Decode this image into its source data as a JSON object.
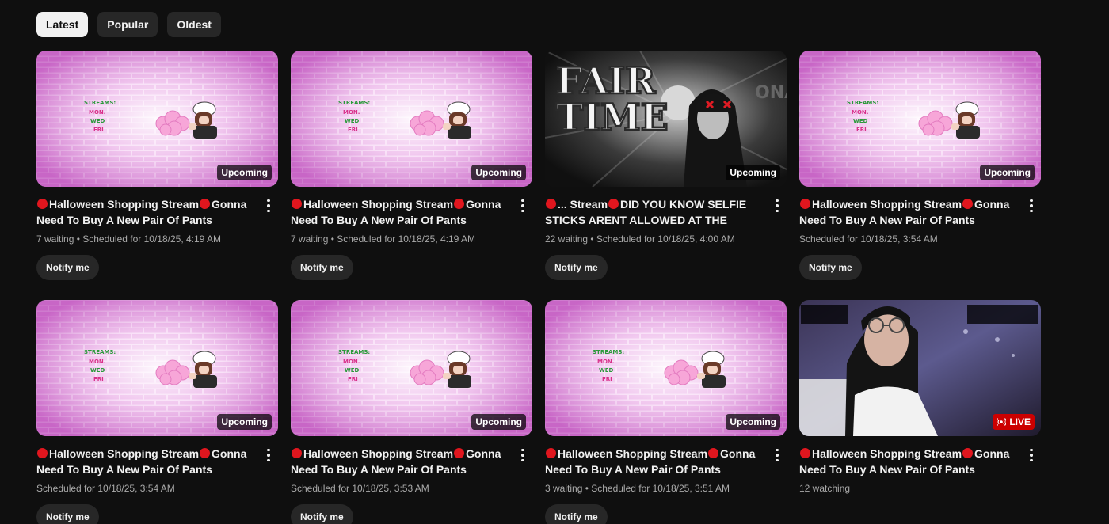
{
  "filters": [
    {
      "label": "Latest",
      "active": true
    },
    {
      "label": "Popular",
      "active": false
    },
    {
      "label": "Oldest",
      "active": false
    }
  ],
  "thumbnail_texts": {
    "fair_time_l1": "FAIR",
    "fair_time_l2": "TIME",
    "streams_sign": "STREAMS: MON. WED FRI"
  },
  "videos": [
    {
      "thumb": "brick",
      "badge": "Upcoming",
      "title_parts": [
        "",
        "Halloween Shopping Stream",
        "Gonna Need To Buy A New Pair Of Pants AFTER..."
      ],
      "sub": "7 waiting • Scheduled for 10/18/25, 4:19 AM",
      "action": "Notify me"
    },
    {
      "thumb": "brick",
      "badge": "Upcoming",
      "title_parts": [
        "",
        "Halloween Shopping Stream",
        "Gonna Need To Buy A New Pair Of Pants AFTER..."
      ],
      "sub": "7 waiting • Scheduled for 10/18/25, 4:19 AM",
      "action": "Notify me"
    },
    {
      "thumb": "fair",
      "badge": "Upcoming",
      "title_parts": [
        "",
        "... Stream",
        "DID YOU KNOW SELFIE STICKS ARENT ALLOWED AT THE FAIR????..."
      ],
      "sub": "22 waiting • Scheduled for 10/18/25, 4:00 AM",
      "action": "Notify me"
    },
    {
      "thumb": "brick",
      "badge": "Upcoming",
      "title_parts": [
        "",
        "Halloween Shopping Stream",
        "Gonna Need To Buy A New Pair Of Pants AFTER..."
      ],
      "sub": "Scheduled for 10/18/25, 3:54 AM",
      "action": "Notify me"
    },
    {
      "thumb": "brick",
      "badge": "Upcoming",
      "title_parts": [
        "",
        "Halloween Shopping Stream",
        "Gonna Need To Buy A New Pair Of Pants AFTER..."
      ],
      "sub": "Scheduled for 10/18/25, 3:54 AM",
      "action": "Notify me"
    },
    {
      "thumb": "brick",
      "badge": "Upcoming",
      "title_parts": [
        "",
        "Halloween Shopping Stream",
        "Gonna Need To Buy A New Pair Of Pants AFTER..."
      ],
      "sub": "Scheduled for 10/18/25, 3:53 AM",
      "action": "Notify me"
    },
    {
      "thumb": "brick",
      "badge": "Upcoming",
      "title_parts": [
        "",
        "Halloween Shopping Stream",
        "Gonna Need To Buy A New Pair Of Pants AFTER..."
      ],
      "sub": "3 waiting • Scheduled for 10/18/25, 3:51 AM",
      "action": "Notify me"
    },
    {
      "thumb": "live",
      "badge": "LIVE",
      "title_parts": [
        "",
        "Halloween Shopping Stream",
        "Gonna Need To Buy A New Pair Of Pants AFTER..."
      ],
      "sub": "12 watching",
      "action": ""
    }
  ],
  "colors": {
    "background": "#0f0f0f",
    "chip": "#272727",
    "chip_active": "#f1f1f1",
    "live_red": "#cc0000",
    "title_dot": "#e0161e",
    "brick_pink": "#e070e0"
  },
  "icons": {
    "more": "more-vert-icon",
    "live": "live-broadcast-icon",
    "title_dot": "red-circle-icon"
  }
}
